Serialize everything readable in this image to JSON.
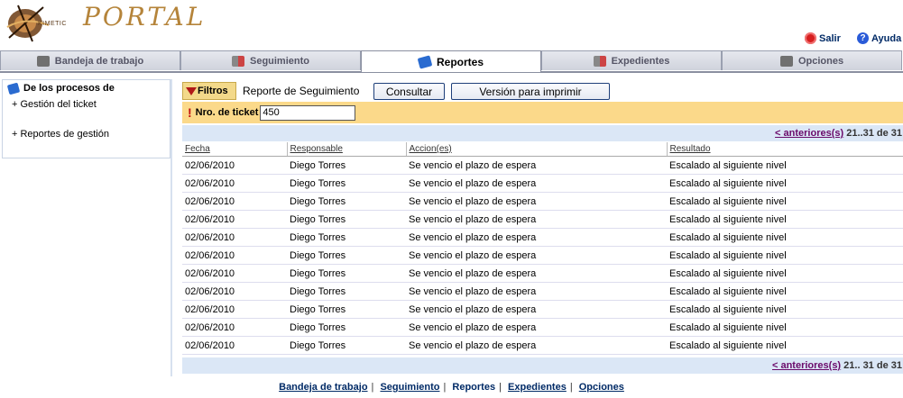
{
  "header": {
    "brand_small": "KIMETIC",
    "brand_title": "PORTAL",
    "salir": "Salir",
    "ayuda": "Ayuda"
  },
  "tabs": [
    {
      "label": "Bandeja de trabajo",
      "icon": "inbox-icon",
      "active": false
    },
    {
      "label": "Seguimiento",
      "icon": "tracking-icon",
      "active": false
    },
    {
      "label": "Reportes",
      "icon": "book-icon",
      "active": true
    },
    {
      "label": "Expedientes",
      "icon": "folder-icon",
      "active": false
    },
    {
      "label": "Opciones",
      "icon": "options-icon",
      "active": false
    }
  ],
  "sidebar": {
    "title": "De los procesos de",
    "items": [
      "+ Gestión del ticket",
      "+ Reportes de gestión"
    ]
  },
  "toolbar": {
    "filters_label": "Filtros",
    "report_title": "Reporte de Seguimiento",
    "consultar_label": "Consultar",
    "imprimir_label": "Versión para imprimir"
  },
  "criteria": {
    "ticket_label": "Nro. de ticket",
    "ticket_value": "450"
  },
  "pager": {
    "prev_label": "< anteriores(s)",
    "range_top": " 21..31 de 31",
    "range_bottom": " 21.. 31 de 31"
  },
  "table": {
    "columns": [
      "Fecha",
      "Responsable",
      "Accion(es)",
      "Resultado"
    ],
    "rows": [
      [
        "02/06/2010",
        "Diego Torres",
        "Se vencio el plazo de espera",
        "Escalado al siguiente nivel"
      ],
      [
        "02/06/2010",
        "Diego Torres",
        "Se vencio el plazo de espera",
        "Escalado al siguiente nivel"
      ],
      [
        "02/06/2010",
        "Diego Torres",
        "Se vencio el plazo de espera",
        "Escalado al siguiente nivel"
      ],
      [
        "02/06/2010",
        "Diego Torres",
        "Se vencio el plazo de espera",
        "Escalado al siguiente nivel"
      ],
      [
        "02/06/2010",
        "Diego Torres",
        "Se vencio el plazo de espera",
        "Escalado al siguiente nivel"
      ],
      [
        "02/06/2010",
        "Diego Torres",
        "Se vencio el plazo de espera",
        "Escalado al siguiente nivel"
      ],
      [
        "02/06/2010",
        "Diego Torres",
        "Se vencio el plazo de espera",
        "Escalado al siguiente nivel"
      ],
      [
        "02/06/2010",
        "Diego Torres",
        "Se vencio el plazo de espera",
        "Escalado al siguiente nivel"
      ],
      [
        "02/06/2010",
        "Diego Torres",
        "Se vencio el plazo de espera",
        "Escalado al siguiente nivel"
      ],
      [
        "02/06/2010",
        "Diego Torres",
        "Se vencio el plazo de espera",
        "Escalado al siguiente nivel"
      ],
      [
        "02/06/2010",
        "Diego Torres",
        "Se vencio el plazo de espera",
        "Escalado al siguiente nivel"
      ]
    ]
  },
  "footer": {
    "links": [
      "Bandeja de trabajo",
      "Seguimiento",
      "Reportes",
      "Expedientes",
      "Opciones"
    ]
  }
}
